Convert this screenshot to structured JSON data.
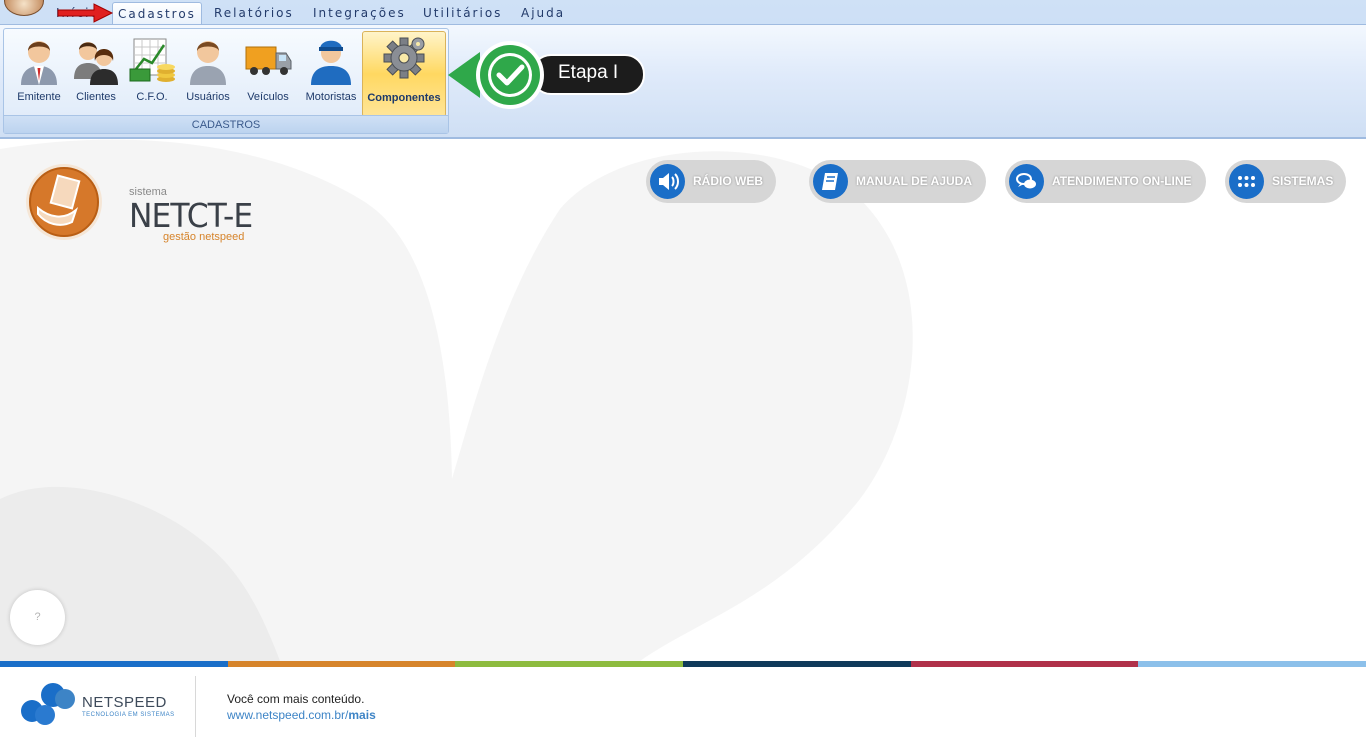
{
  "menu": {
    "tabs": [
      {
        "label": "Início"
      },
      {
        "label": "Cadastros"
      },
      {
        "label": "Relatórios"
      },
      {
        "label": "Integrações"
      },
      {
        "label": "Utilitários"
      },
      {
        "label": "Ajuda"
      }
    ]
  },
  "ribbon": {
    "group_label": "CADASTROS",
    "buttons": [
      {
        "label": "Emitente",
        "icon": "user-tie-icon"
      },
      {
        "label": "Clientes",
        "icon": "clients-icon"
      },
      {
        "label": "C.F.O.",
        "icon": "cfo-icon"
      },
      {
        "label": "Usuários",
        "icon": "user-icon"
      },
      {
        "label": "Veículos",
        "icon": "truck-icon"
      },
      {
        "label": "Motoristas",
        "icon": "driver-icon"
      },
      {
        "label": "Componentes",
        "icon": "gear-icon"
      }
    ],
    "selected": "Componentes"
  },
  "annotation": {
    "label": "Etapa I"
  },
  "logo": {
    "sub": "sistema",
    "title": "NETCT-E",
    "tag": "gestão netspeed"
  },
  "links": [
    {
      "label": "RÁDIO WEB",
      "icon": "speaker-icon"
    },
    {
      "label": "MANUAL DE AJUDA",
      "icon": "book-icon"
    },
    {
      "label": "ATENDIMENTO ON-LINE",
      "icon": "chat-icon"
    },
    {
      "label": "SISTEMAS",
      "icon": "grid-icon"
    }
  ],
  "help": {
    "label": "?"
  },
  "footer": {
    "brand": "NETSPEED",
    "brand_tag": "TECNOLOGIA EM SISTEMAS",
    "text": "Você com mais conteúdo.",
    "link_prefix": "www.netspeed.com.br/",
    "link_bold": "mais",
    "stripe_colors": [
      "#1a6ec8",
      "#d6842b",
      "#8dbb3f",
      "#0f3a5a",
      "#b0314a",
      "#8cc0ea"
    ]
  },
  "colors": {
    "accent": "#1a6ec8",
    "selected_button": "#ffd861",
    "ribbon": "#c3d9f3"
  }
}
